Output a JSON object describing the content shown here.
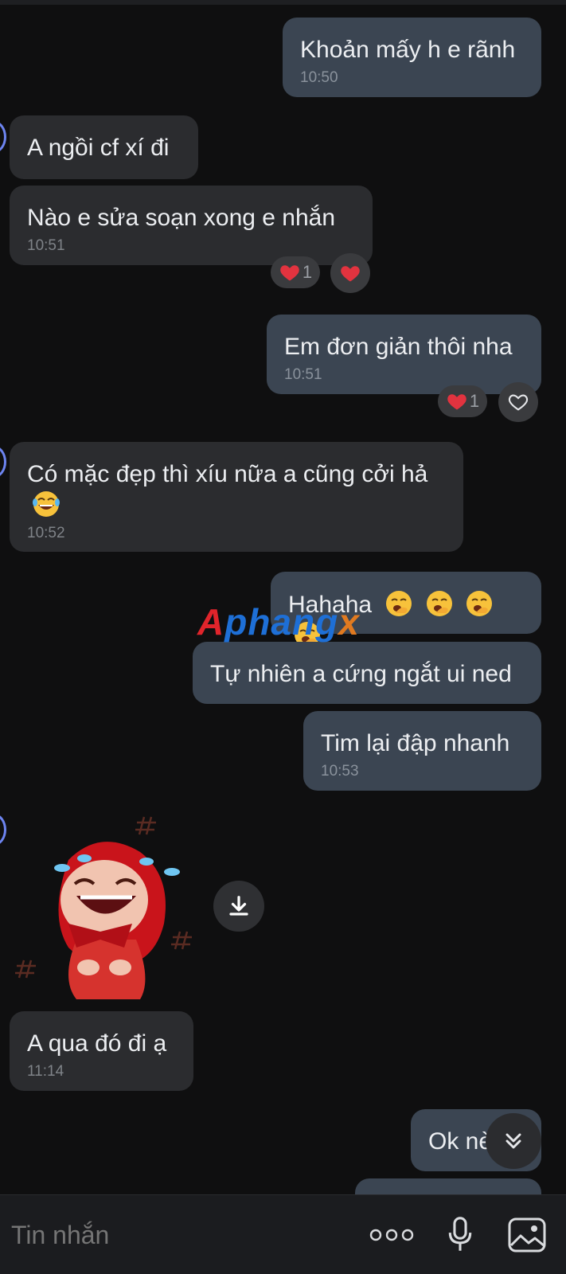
{
  "messages": [
    {
      "text": "Khoản mấy h e rãnh",
      "time": "10:50"
    },
    {
      "text": "A ngồi cf xí đi"
    },
    {
      "text": "Nào e sửa soạn xong e nhắn",
      "time": "10:51",
      "reaction_count": "1"
    },
    {
      "text": "Em đơn giản thôi nha",
      "time": "10:51",
      "reaction_count": "1"
    },
    {
      "text": "Có mặc đẹp thì xíu nữa a cũng cởi hả",
      "time": "10:52"
    },
    {
      "text": "Hahaha"
    },
    {
      "text": "Tự nhiên a cứng ngắt ui ned"
    },
    {
      "text": "Tim lại đập nhanh",
      "time": "10:53"
    },
    {
      "text": "A qua đó đi ạ",
      "time": "11:14"
    },
    {
      "text": "Ok nè"
    }
  ],
  "watermark": {
    "part1": "A",
    "part2": "phang",
    "part3": "x"
  },
  "composer": {
    "placeholder": "Tin nhắn"
  },
  "icons": [
    "heart-icon",
    "heart-outline-icon",
    "laughing-emoji",
    "yawning-emoji",
    "download-icon",
    "chevron-down-icon",
    "more-icon",
    "microphone-icon",
    "image-icon"
  ],
  "colors": {
    "outgoing_bubble": "#3b4552",
    "incoming_bubble": "#2b2c2f",
    "background": "#0f0f10",
    "heart": "#e2333f",
    "avatar_ring": "#6d84f0"
  }
}
